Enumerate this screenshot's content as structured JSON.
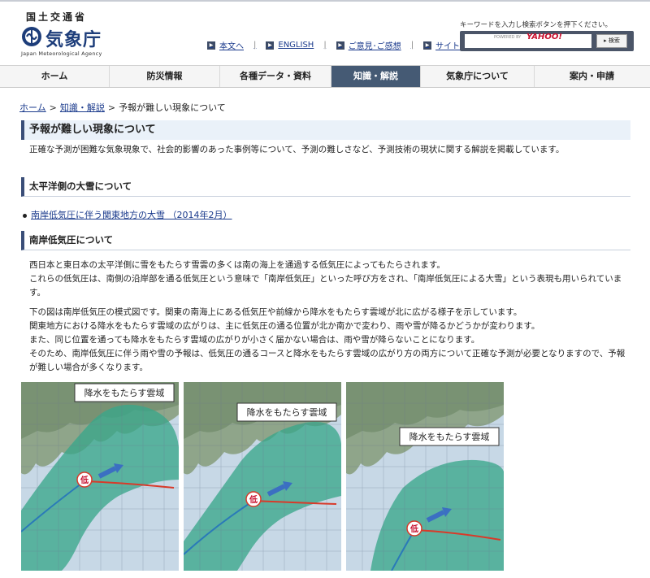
{
  "header": {
    "ministry": "国土交通省",
    "agency_jp": "気象庁",
    "agency_en": "Japan Meteorological Agency",
    "links": [
      {
        "label": "本文へ"
      },
      {
        "label": "ENGLISH"
      },
      {
        "label": "ご意見･ご感想"
      },
      {
        "label": "サイトマップ"
      }
    ],
    "search": {
      "hint": "キーワードを入力し検索ボタンを押下ください。",
      "powered": "POWERED BY",
      "brand": "YAHOO!",
      "button": "検索"
    }
  },
  "nav": {
    "items": [
      {
        "label": "ホーム"
      },
      {
        "label": "防災情報"
      },
      {
        "label": "各種データ・資料"
      },
      {
        "label": "知識・解説",
        "active": true
      },
      {
        "label": "気象庁について"
      },
      {
        "label": "案内・申請"
      }
    ]
  },
  "breadcrumb": {
    "home": "ホーム",
    "knowledge": "知識・解説",
    "current": "予報が難しい現象について",
    "sep": ">"
  },
  "page": {
    "title": "予報が難しい現象について",
    "lead": "正確な予測が困難な気象現象で、社会的影響のあった事例等について、予測の難しさなど、予測技術の現状に関する解説を掲載しています。"
  },
  "sections": {
    "pacific_snow": {
      "heading": "太平洋側の大雪について",
      "link": "南岸低気圧に伴う関東地方の大雪 （2014年2月）"
    },
    "south_coast_low": {
      "heading": "南岸低気圧について",
      "p1a": "西日本と東日本の太平洋側に雪をもたらす雪雲の多くは南の海上を通過する低気圧によってもたらされます。",
      "p1b": "これらの低気圧は、南側の沿岸部を通る低気圧という意味で「南岸低気圧」といった呼び方をされ、「南岸低気圧による大雪」という表現も用いられています。",
      "p2a": "下の図は南岸低気圧の模式図です。関東の南海上にある低気圧や前線から降水をもたらす雲域が北に広がる様子を示しています。",
      "p2b": "関東地方における降水をもたらす雲域の広がりは、主に低気圧の通る位置が北か南かで変わり、雨や雪が降るかどうかが変わります。",
      "p2c": "また、同じ位置を通っても降水をもたらす雲域の広がりが小さく届かない場合は、雨や雪が降らないことになります。",
      "p2d": "そのため、南岸低気圧に伴う雨や雪の予報は、低気圧の通るコースと降水をもたらす雲域の広がり方の両方について正確な予測が必要となりますので、予報が難しい場合が多くなります。"
    }
  },
  "maps": [
    {
      "label": "降水をもたらす雲域",
      "low": "低"
    },
    {
      "label": "降水をもたらす雲域",
      "low": "低"
    },
    {
      "label": "降水をもたらす雲域",
      "low": "低"
    }
  ],
  "colors": {
    "nav_active": "#455a74",
    "link": "#1a3a8c",
    "cloud": "#3aa68a",
    "front": "#d83a2a",
    "track": "#2a7ab8"
  }
}
